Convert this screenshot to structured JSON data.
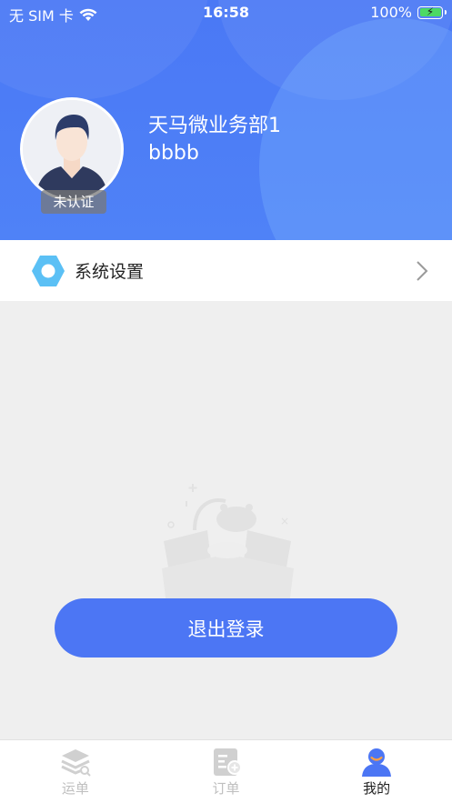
{
  "status_bar": {
    "carrier": "无 SIM 卡",
    "time": "16:58",
    "battery": "100%"
  },
  "profile": {
    "name": "天马微业务部1",
    "account": "bbbb",
    "verify_status": "未认证"
  },
  "settings": {
    "label": "系统设置"
  },
  "logout": {
    "label": "退出登录"
  },
  "tabs": [
    {
      "label": "运单",
      "icon": "waybill-icon",
      "active": false
    },
    {
      "label": "订单",
      "icon": "order-icon",
      "active": false
    },
    {
      "label": "我的",
      "icon": "profile-icon",
      "active": true
    }
  ],
  "colors": {
    "primary": "#4c76f4",
    "settings_icon": "#5bc0f5",
    "active_tab": "#4c76f4"
  }
}
